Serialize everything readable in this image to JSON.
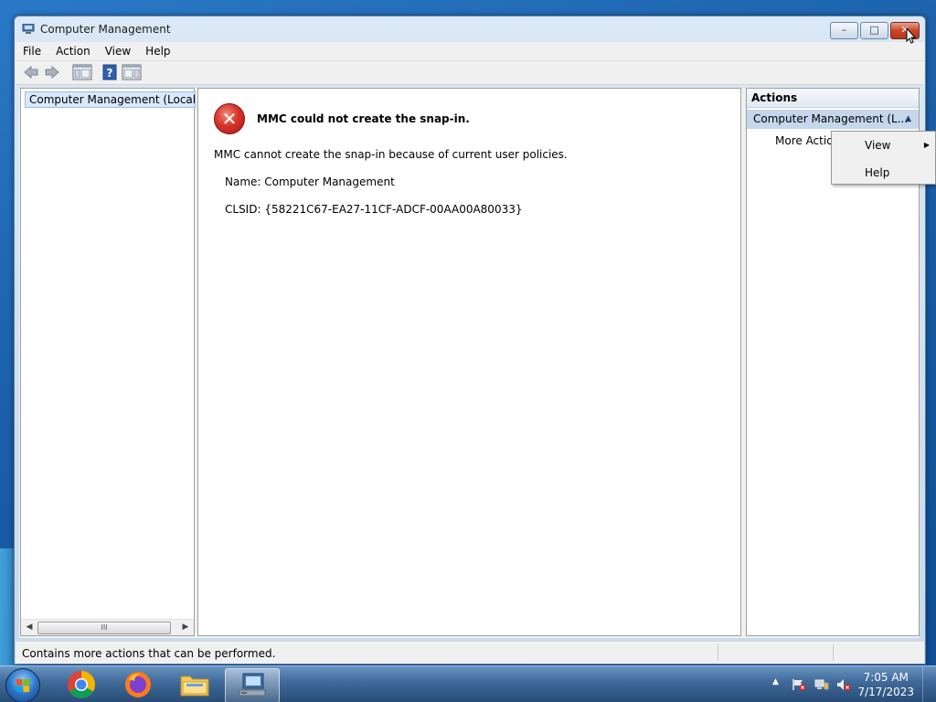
{
  "window": {
    "title": "Computer Management",
    "controls": {
      "minimize": "–",
      "maximize": "□",
      "close": "✕"
    }
  },
  "menubar": [
    "File",
    "Action",
    "View",
    "Help"
  ],
  "toolbar": {
    "icons": [
      "back-arrow-icon",
      "forward-arrow-icon",
      "show-hide-console-tree-icon",
      "help-icon",
      "show-hide-action-pane-icon"
    ]
  },
  "tree": {
    "root_label": "Computer Management (Local"
  },
  "scrollbar": {
    "thumb_grip": "III",
    "left_arrow": "◀",
    "right_arrow": "▶"
  },
  "error": {
    "title": "MMC could not create the snap-in.",
    "message": "MMC cannot create the snap-in because of current user policies.",
    "name_line": "Name: Computer Management",
    "clsid_line": "CLSID: {58221C67-EA27-11CF-ADCF-00AA00A80033}"
  },
  "actions": {
    "header": "Actions",
    "group": "Computer Management (L...",
    "more": "More Actions"
  },
  "context_menu": {
    "items": [
      {
        "label": "View",
        "has_submenu": true
      },
      {
        "label": "Help",
        "has_submenu": false
      }
    ],
    "submenu_arrow": "▶"
  },
  "statusbar": {
    "text": "Contains more actions that can be performed."
  },
  "taskbar": {
    "apps": [
      "chrome",
      "firefox",
      "file-explorer",
      "computer-management"
    ],
    "active_app": "computer-management",
    "tray_overflow": "▲",
    "clock": {
      "time": "7:05 AM",
      "date": "7/17/2023"
    }
  },
  "colors": {
    "desktop": "#1b5fa8",
    "error_red": "#d8332a",
    "selection": "#c6d7ed"
  }
}
